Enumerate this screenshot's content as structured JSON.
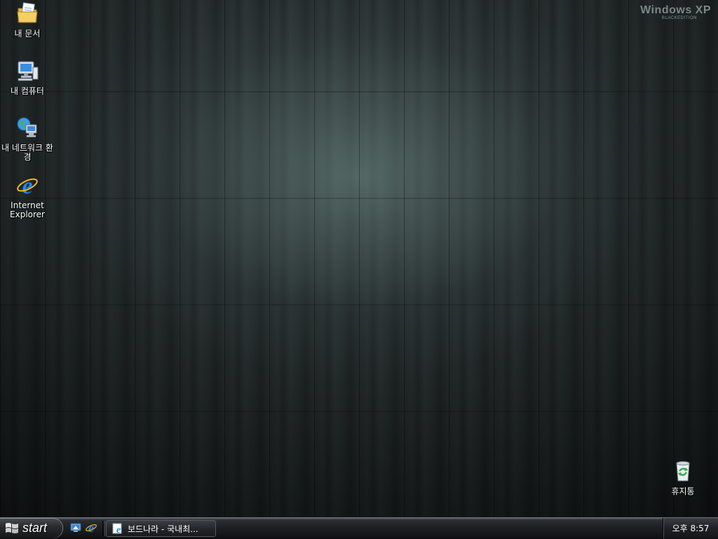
{
  "brand": {
    "title": "Windows XP",
    "subtitle": "BLACKEDITION"
  },
  "desktop_icons": [
    {
      "label": "내 문서",
      "icon": "my-documents-icon"
    },
    {
      "label": "내 컴퓨터",
      "icon": "my-computer-icon"
    },
    {
      "label": "내 네트워크 환경",
      "icon": "my-network-places-icon"
    },
    {
      "label": "Internet Explorer",
      "icon": "internet-explorer-icon"
    },
    {
      "label": "휴지통",
      "icon": "recycle-bin-icon"
    }
  ],
  "taskbar": {
    "start_label": "start",
    "quick_launch": [
      {
        "icon": "show-desktop-icon"
      },
      {
        "icon": "internet-explorer-icon"
      }
    ],
    "tasks": [
      {
        "label": "보드나라 - 국내최...",
        "icon": "internet-explorer-page-icon"
      }
    ],
    "clock": "오후 8:57"
  },
  "colors": {
    "taskbar": "#1d1f23",
    "label_text": "#ffffff",
    "brand_text": "#7b8788"
  }
}
